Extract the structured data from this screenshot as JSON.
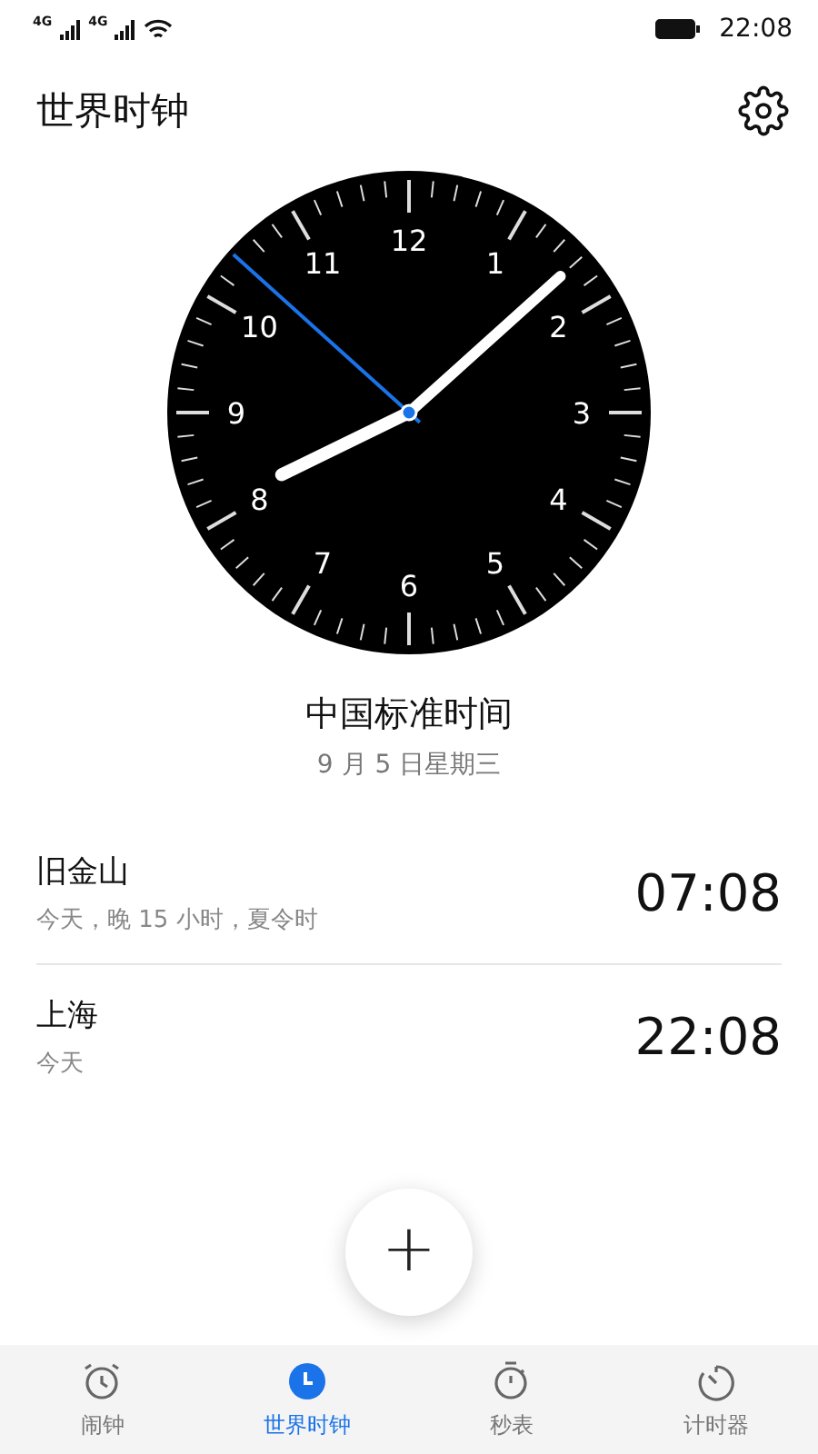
{
  "status_bar": {
    "signal_1": "4G",
    "signal_2": "4G",
    "time": "22:08"
  },
  "header": {
    "title": "世界时钟"
  },
  "clock": {
    "numerals": [
      "12",
      "1",
      "2",
      "3",
      "4",
      "5",
      "6",
      "7",
      "8",
      "9",
      "10",
      "11"
    ]
  },
  "local": {
    "zone": "中国标准时间",
    "date": "9 月 5 日星期三"
  },
  "cities": [
    {
      "name": "旧金山",
      "detail": "今天，晚 15 小时，夏令时",
      "time": "07:08"
    },
    {
      "name": "上海",
      "detail": "今天",
      "time": "22:08"
    }
  ],
  "fab": {
    "label": "+"
  },
  "tabs": [
    {
      "label": "闹钟",
      "kind": "alarm",
      "selected": false
    },
    {
      "label": "世界时钟",
      "kind": "clock",
      "selected": true
    },
    {
      "label": "秒表",
      "kind": "stopwatch",
      "selected": false
    },
    {
      "label": "计时器",
      "kind": "timer",
      "selected": false
    }
  ]
}
